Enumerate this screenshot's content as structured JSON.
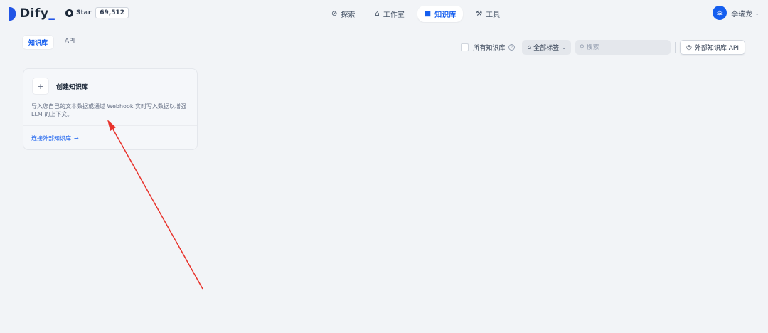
{
  "header": {
    "logo_text": "Dify",
    "logo_underscore": "_",
    "github": {
      "star_label": "Star",
      "star_count": "69,512"
    },
    "nav": [
      {
        "label": "探索",
        "icon": "compass-icon",
        "active": false
      },
      {
        "label": "工作室",
        "icon": "robot-icon",
        "active": false
      },
      {
        "label": "知识库",
        "icon": "book-icon",
        "active": true
      },
      {
        "label": "工具",
        "icon": "hammer-icon",
        "active": false
      }
    ],
    "user": {
      "avatar_letter": "李",
      "name": "李瑞龙"
    }
  },
  "tabs": [
    {
      "label": "知识库",
      "active": true
    },
    {
      "label": "API",
      "active": false
    }
  ],
  "toolbar": {
    "all_kb_label": "所有知识库",
    "tag_filter_label": "全部标签",
    "search_placeholder": "搜索",
    "ext_api_label": "外部知识库 API"
  },
  "create_card": {
    "title": "创建知识库",
    "description": "导入您自己的文本数据或通过 Webhook 实时写入数据以增强 LLM 的上下文。",
    "connect_external_label": "连接外部知识库"
  },
  "colors": {
    "accent": "#155eef",
    "background": "#f2f4f7",
    "annotation_arrow": "#e8322b"
  }
}
